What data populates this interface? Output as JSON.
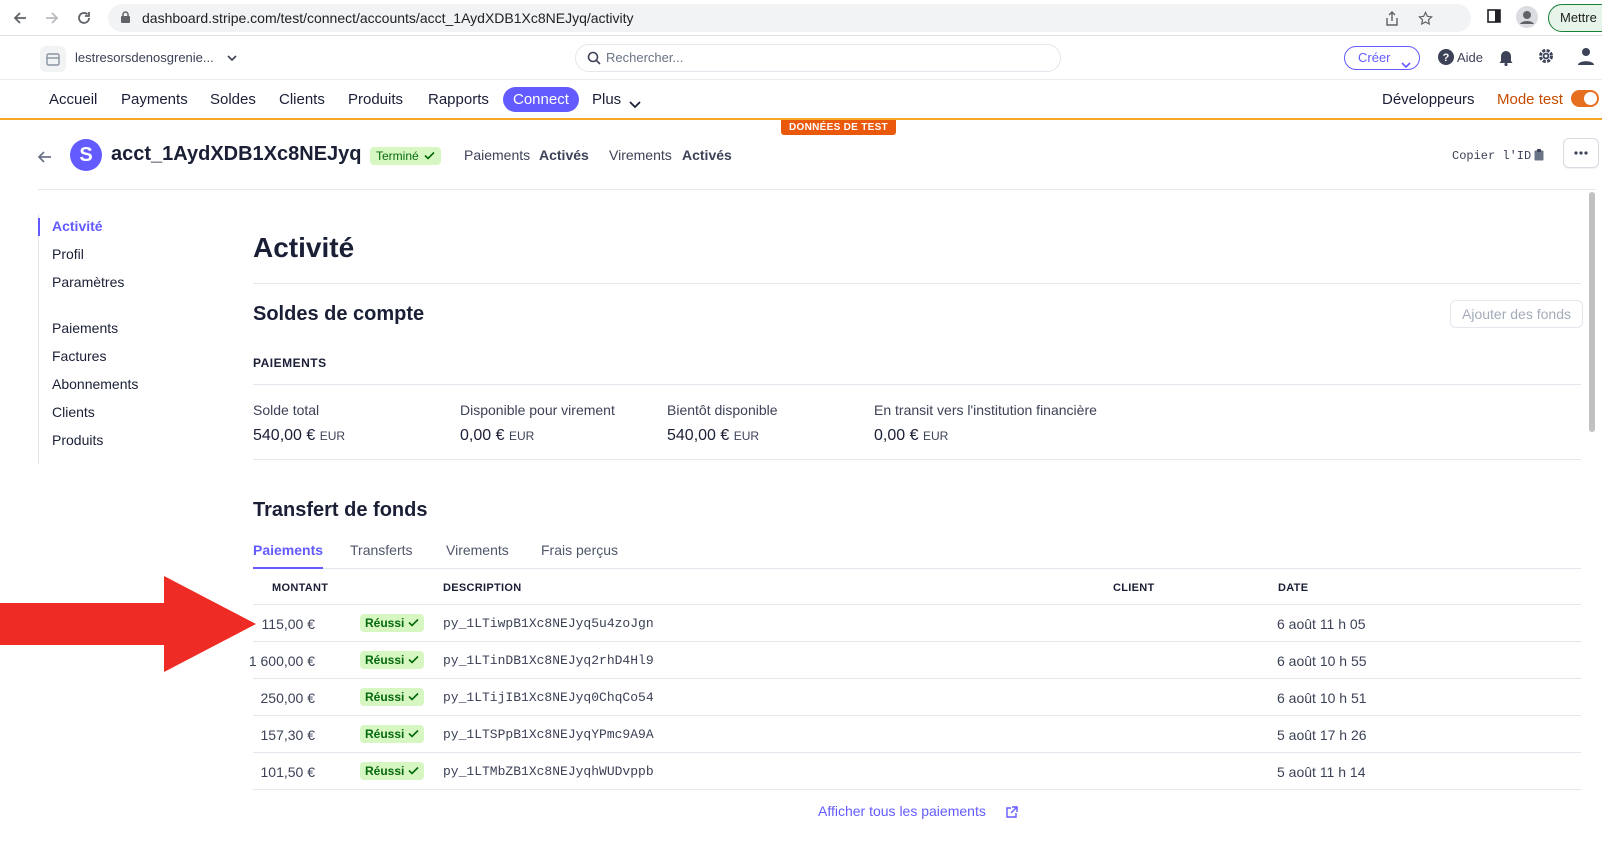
{
  "browser": {
    "url": "dashboard.stripe.com/test/connect/accounts/acct_1AydXDB1Xc8NEJyq/activity",
    "profile_label": "Mettre"
  },
  "topbar": {
    "account_name": "lestresorsdenosgrenie...",
    "search_placeholder": "Rechercher...",
    "create_label": "Créer",
    "help_label": "Aide"
  },
  "nav": {
    "items": [
      "Accueil",
      "Payments",
      "Soldes",
      "Clients",
      "Produits",
      "Rapports"
    ],
    "active": "Connect",
    "more": "Plus",
    "developers": "Développeurs",
    "test_mode": "Mode test",
    "test_data_banner": "DONNÉES DE TEST"
  },
  "account": {
    "id": "acct_1AydXDB1Xc8NEJyq",
    "avatar_letter": "S",
    "status": "Terminé",
    "payments_label": "Paiements",
    "payments_value": "Activés",
    "payouts_label": "Virements",
    "payouts_value": "Activés",
    "copy_id_label": "Copier l'ID"
  },
  "sidebar": {
    "items": [
      "Activité",
      "Profil",
      "Paramètres",
      "Paiements",
      "Factures",
      "Abonnements",
      "Clients",
      "Produits"
    ]
  },
  "page": {
    "title": "Activité",
    "balances_title": "Soldes de compte",
    "add_funds": "Ajouter des fonds",
    "payments_subhead": "PAIEMENTS",
    "balances": [
      {
        "label": "Solde total",
        "amount": "540,00 €",
        "currency": "EUR"
      },
      {
        "label": "Disponible pour virement",
        "amount": "0,00 €",
        "currency": "EUR"
      },
      {
        "label": "Bientôt disponible",
        "amount": "540,00 €",
        "currency": "EUR"
      },
      {
        "label": "En transit vers l'institution financière",
        "amount": "0,00 €",
        "currency": "EUR"
      }
    ],
    "transfers_title": "Transfert de fonds",
    "tabs": [
      "Paiements",
      "Transferts",
      "Virements",
      "Frais perçus"
    ],
    "columns": {
      "amount": "MONTANT",
      "description": "DESCRIPTION",
      "client": "CLIENT",
      "date": "DATE"
    },
    "rows": [
      {
        "amount": "115,00 €",
        "status": "Réussi",
        "description": "py_1LTiwpB1Xc8NEJyq5u4zoJgn",
        "date": "6 août 11 h 05"
      },
      {
        "amount": "1 600,00 €",
        "status": "Réussi",
        "description": "py_1LTinDB1Xc8NEJyq2rhD4Hl9",
        "date": "6 août 10 h 55"
      },
      {
        "amount": "250,00 €",
        "status": "Réussi",
        "description": "py_1LTijIB1Xc8NEJyq0ChqCo54",
        "date": "6 août 10 h 51"
      },
      {
        "amount": "157,30 €",
        "status": "Réussi",
        "description": "py_1LTSPpB1Xc8NEJyqYPmc9A9A",
        "date": "5 août 17 h 26"
      },
      {
        "amount": "101,50 €",
        "status": "Réussi",
        "description": "py_1LTMbZB1Xc8NEJyqhWUDvppb",
        "date": "5 août 11 h 14"
      }
    ],
    "show_all": "Afficher tous les paiements"
  },
  "colors": {
    "accent": "#635bff",
    "success_bg": "#d7f7c2",
    "success_text": "#05690d",
    "test_orange": "#ea580c",
    "annotation_red": "#ee2b24"
  }
}
